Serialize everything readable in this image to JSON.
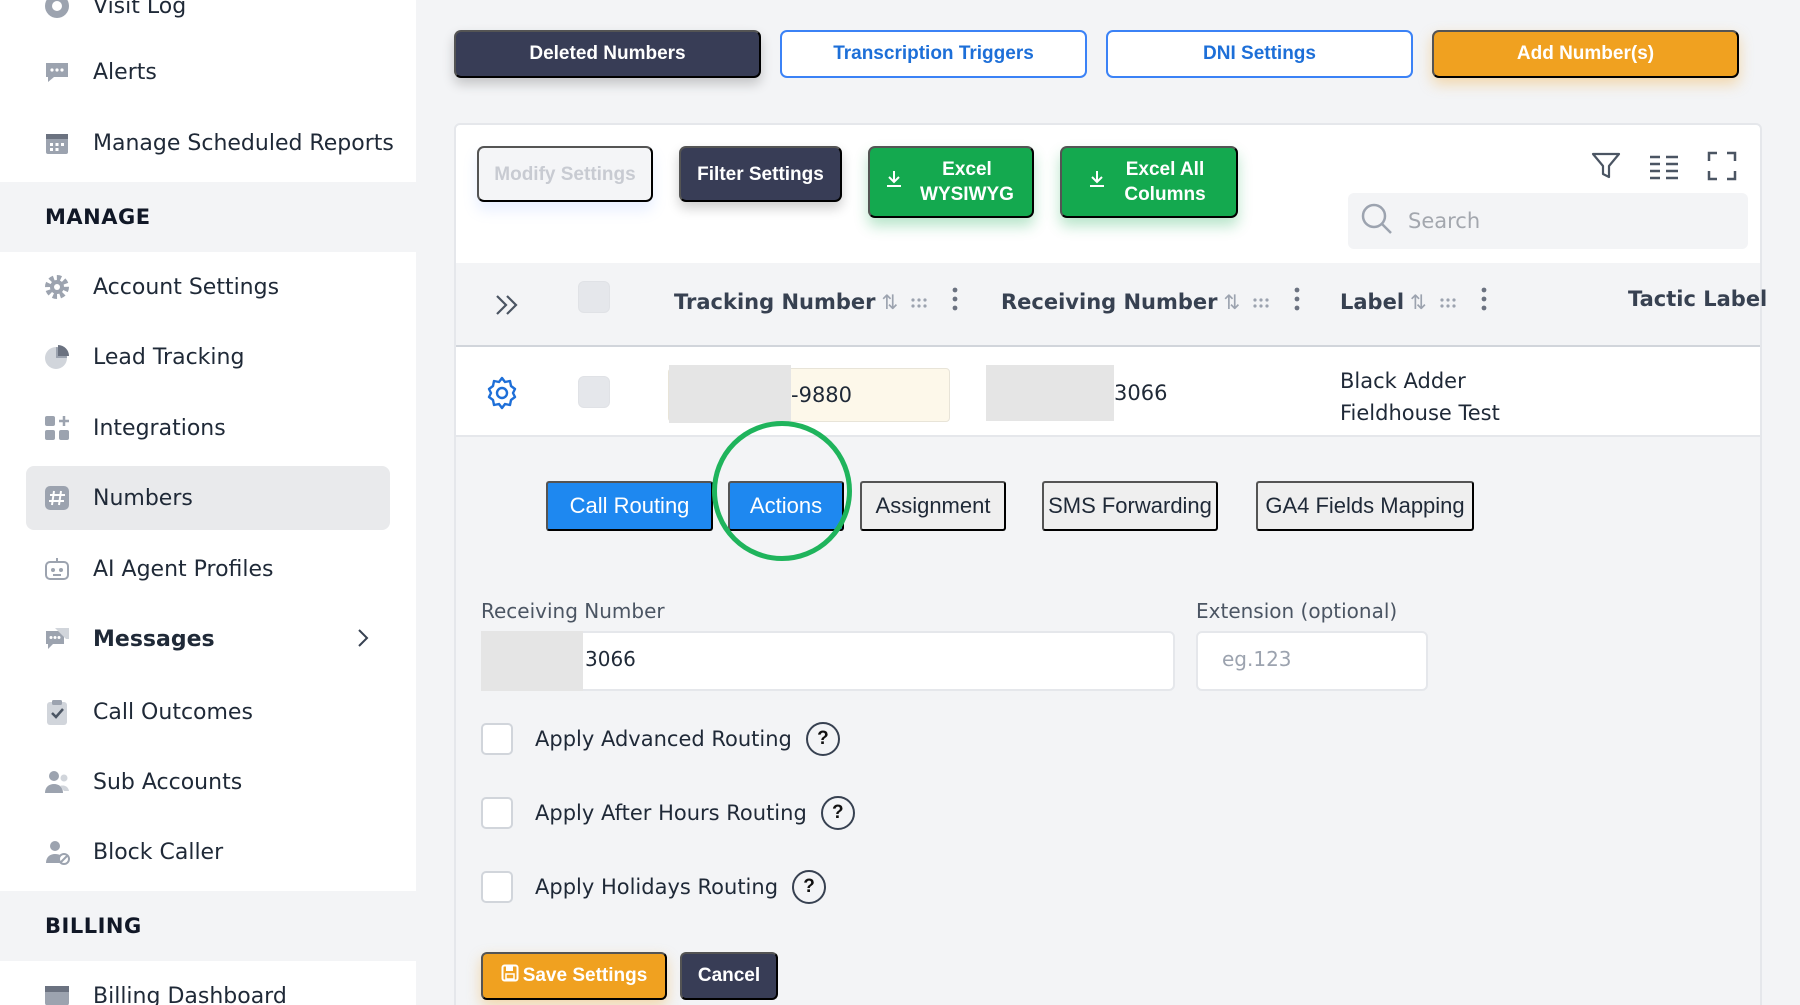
{
  "sidebar": {
    "items": [
      {
        "label": "Visit Log",
        "icon": "eye-icon"
      },
      {
        "label": "Alerts",
        "icon": "chat-bubble-icon"
      },
      {
        "label": "Manage Scheduled Reports",
        "icon": "calendar-icon"
      },
      {
        "label": "Account Settings",
        "icon": "gear-icon"
      },
      {
        "label": "Lead Tracking",
        "icon": "pie-chart-icon"
      },
      {
        "label": "Integrations",
        "icon": "grid-plus-icon"
      },
      {
        "label": "Numbers",
        "icon": "hash-icon"
      },
      {
        "label": "AI Agent Profiles",
        "icon": "robot-icon"
      },
      {
        "label": "Messages",
        "icon": "chat-bubble-icon"
      },
      {
        "label": "Call Outcomes",
        "icon": "clipboard-check-icon"
      },
      {
        "label": "Sub Accounts",
        "icon": "users-icon"
      },
      {
        "label": "Block Caller",
        "icon": "user-block-icon"
      },
      {
        "label": "Billing Dashboard",
        "icon": "dashboard-icon"
      }
    ],
    "sections": {
      "manage": "MANAGE",
      "billing": "BILLING"
    }
  },
  "top_actions": {
    "deleted_numbers": "Deleted Numbers",
    "transcription_triggers": "Transcription Triggers",
    "dni_settings": "DNI Settings",
    "add_numbers": "Add Number(s)"
  },
  "toolbar": {
    "modify_settings": "Modify Settings",
    "filter_settings": "Filter Settings",
    "excel_wysiwyg": "Excel WYSIWYG",
    "excel_all_columns": "Excel All Columns",
    "search_placeholder": "Search"
  },
  "table": {
    "columns": [
      "Tracking Number",
      "Receiving Number",
      "Label",
      "Tactic Label"
    ],
    "row": {
      "tracking_suffix": "-9880",
      "receiving_suffix": "3066",
      "label_line1": "Black Adder",
      "label_line2": "Fieldhouse Test"
    }
  },
  "details": {
    "tabs": [
      "Call Routing",
      "Actions",
      "Assignment",
      "SMS Forwarding",
      "GA4 Fields Mapping"
    ],
    "receiving_number_label": "Receiving Number",
    "receiving_number_value": "3066",
    "extension_label": "Extension (optional)",
    "extension_placeholder": "eg.123",
    "options": [
      "Apply Advanced Routing",
      "Apply After Hours Routing",
      "Apply Holidays Routing"
    ],
    "help_glyph": "?",
    "save_label": "Save Settings",
    "cancel_label": "Cancel"
  },
  "colors": {
    "accent_blue": "#1e88f0",
    "brand_orange": "#f0a120",
    "excel_green": "#14a94f",
    "dark_button": "#383d56",
    "highlight_green": "#1fb45c"
  }
}
